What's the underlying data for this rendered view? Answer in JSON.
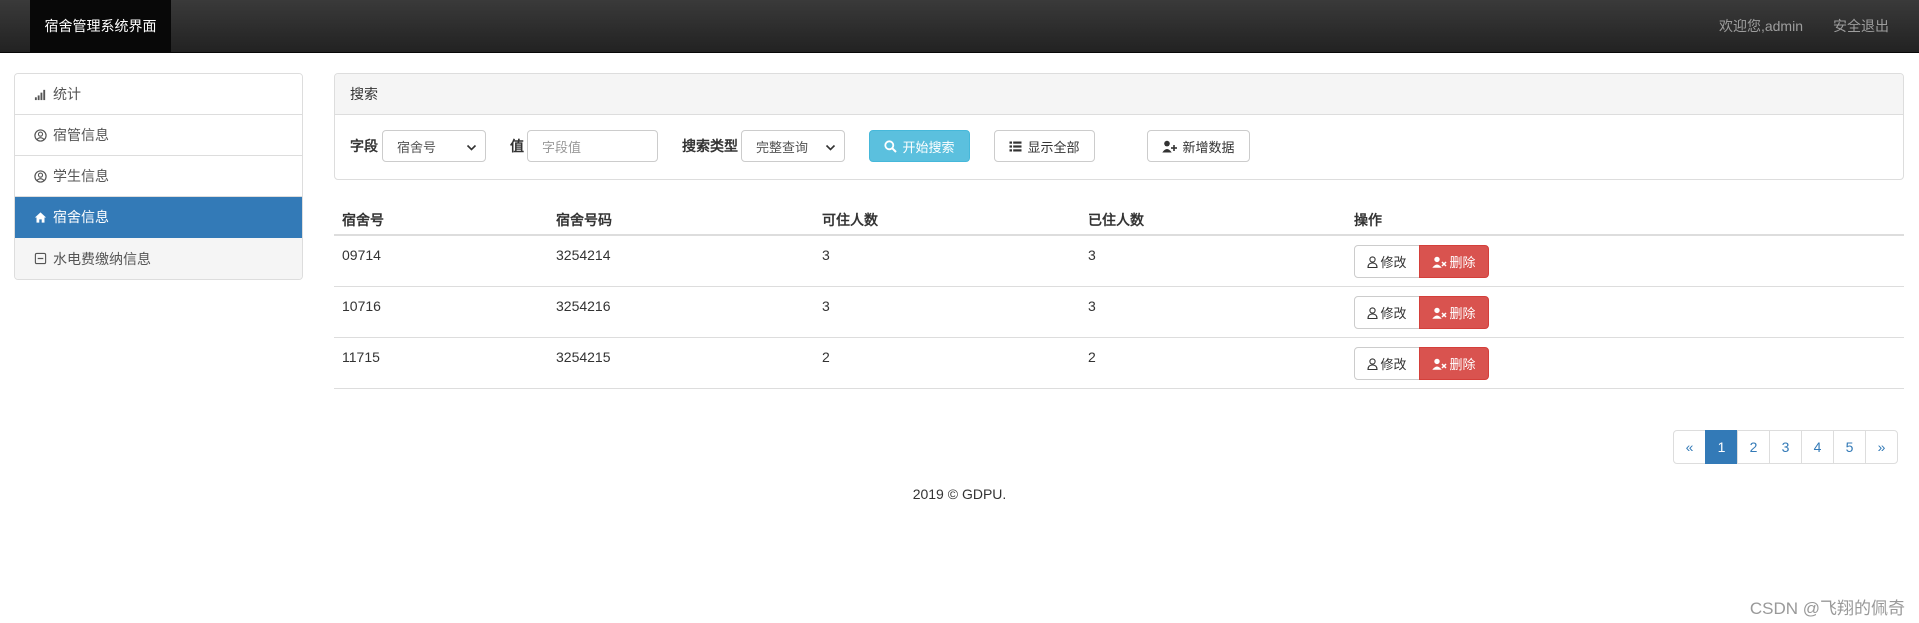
{
  "navbar": {
    "brand": "宿舍管理系统界面",
    "welcome": "欢迎您,admin",
    "logout": "安全退出"
  },
  "sidebar": {
    "items": [
      {
        "label": "统计",
        "icon": "signal-bars-icon"
      },
      {
        "label": "宿管信息",
        "icon": "user-circle-icon"
      },
      {
        "label": "学生信息",
        "icon": "user-circle-icon"
      },
      {
        "label": "宿舍信息",
        "icon": "home-icon",
        "active": true
      },
      {
        "label": "水电费缴纳信息",
        "icon": "minus-square-icon"
      }
    ]
  },
  "search": {
    "heading": "搜索",
    "field_label": "字段",
    "field_value": "宿舍号",
    "value_label": "值",
    "value_placeholder": "字段值",
    "type_label": "搜索类型",
    "type_value": "完整查询",
    "search_button": "开始搜索",
    "show_all_button": "显示全部",
    "add_button": "新增数据"
  },
  "table": {
    "headers": [
      "宿舍号",
      "宿舍号码",
      "可住人数",
      "已住人数",
      "操作"
    ],
    "rows": [
      {
        "dorm_no": "09714",
        "dorm_code": "3254214",
        "capacity": "3",
        "occupied": "3"
      },
      {
        "dorm_no": "10716",
        "dorm_code": "3254216",
        "capacity": "3",
        "occupied": "3"
      },
      {
        "dorm_no": "11715",
        "dorm_code": "3254215",
        "capacity": "2",
        "occupied": "2"
      }
    ],
    "edit_label": "修改",
    "delete_label": "删除"
  },
  "pagination": {
    "prev": "«",
    "pages": [
      "1",
      "2",
      "3",
      "4",
      "5"
    ],
    "active": "1",
    "next": "»"
  },
  "footer": "2019 © GDPU.",
  "watermark": "CSDN @飞翔的佩奇",
  "colors": {
    "primary": "#337ab7",
    "info": "#5bc0de",
    "danger": "#d9534f",
    "navbar": "#222222"
  }
}
